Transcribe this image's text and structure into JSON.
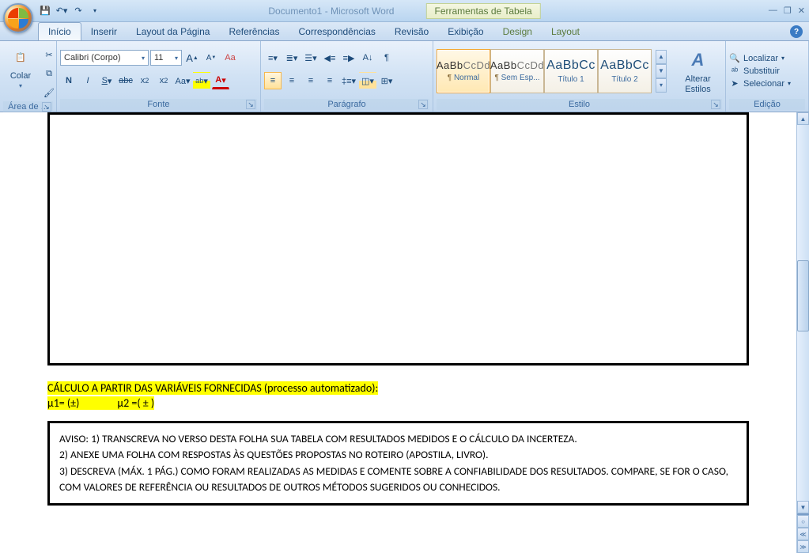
{
  "titlebar": {
    "doc_title": "Documento1 - Microsoft Word",
    "table_tools": "Ferramentas de Tabela"
  },
  "tabs": {
    "inicio": "Início",
    "inserir": "Inserir",
    "layout_pagina": "Layout da Página",
    "referencias": "Referências",
    "correspondencias": "Correspondências",
    "revisao": "Revisão",
    "exibicao": "Exibição",
    "design": "Design",
    "layout": "Layout"
  },
  "ribbon": {
    "clipboard": {
      "label": "Área de ...",
      "paste": "Colar"
    },
    "font": {
      "label": "Fonte",
      "family": "Calibri (Corpo)",
      "size": "11"
    },
    "paragraph": {
      "label": "Parágrafo"
    },
    "styles": {
      "label": "Estilo",
      "change": "Alterar Estilos",
      "items": [
        {
          "sample": "AaBbCcDd",
          "name": "Normal",
          "para": "¶ "
        },
        {
          "sample": "AaBbCcDd",
          "name": "Sem Esp...",
          "para": "¶ "
        },
        {
          "sample": "AaBbCc",
          "name": "Título 1",
          "para": ""
        },
        {
          "sample": "AaBbCc",
          "name": "Título 2",
          "para": ""
        }
      ]
    },
    "editing": {
      "label": "Edição",
      "find": "Localizar",
      "replace": "Substituir",
      "select": "Selecionar"
    }
  },
  "document": {
    "calc_title": "CÁLCULO A PARTIR DAS VARIÁVEIS FORNECIDAS (processo automatizado):",
    "mu1": "μ1=  (±)",
    "mu2": "μ2 =(  ±  )",
    "aviso_l1": "AVISO: 1) TRANSCREVA NO VERSO DESTA FOLHA SUA TABELA COM RESULTADOS MEDIDOS E O CÁLCULO DA INCERTEZA.",
    "aviso_l2": "2) ANEXE UMA FOLHA COM RESPOSTAS ÀS QUESTÕES PROPOSTAS NO ROTEIRO (APOSTILA, LIVRO).",
    "aviso_l3": "3) DESCREVA (MÁX. 1 PÁG.) COMO FORAM REALIZADAS AS MEDIDAS E COMENTE SOBRE A CONFIABILIDADE DOS RESULTADOS. COMPARE, SE FOR O CASO, COM VALORES DE REFERÊNCIA OU RESULTADOS DE OUTROS MÉTODOS SUGERIDOS OU CONHECIDOS."
  }
}
